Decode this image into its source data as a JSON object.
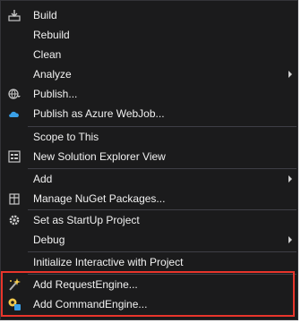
{
  "colors": {
    "menu_background": "#1b1b1c",
    "text": "#f1f1f1",
    "separator": "#3f3f46",
    "highlight_border": "#e8352b",
    "icon_blue": "#3aa0e8"
  },
  "menu": {
    "items": [
      {
        "label": "Build",
        "icon": "build-icon"
      },
      {
        "label": "Rebuild",
        "icon": ""
      },
      {
        "label": "Clean",
        "icon": ""
      },
      {
        "label": "Analyze",
        "icon": "",
        "submenu": true
      },
      {
        "label": "Publish...",
        "icon": "globe-publish-icon"
      },
      {
        "label": "Publish as Azure WebJob...",
        "icon": "azure-cloud-icon"
      },
      {
        "label": "Scope to This",
        "icon": ""
      },
      {
        "label": "New Solution Explorer View",
        "icon": "solution-explorer-icon"
      },
      {
        "label": "Add",
        "icon": "",
        "submenu": true
      },
      {
        "label": "Manage NuGet Packages...",
        "icon": "nuget-package-icon"
      },
      {
        "label": "Set as StartUp Project",
        "icon": "gear-icon"
      },
      {
        "label": "Debug",
        "icon": "",
        "submenu": true
      },
      {
        "label": "Initialize Interactive with Project",
        "icon": ""
      },
      {
        "label": "Add RequestEngine...",
        "icon": "magic-wand-icon"
      },
      {
        "label": "Add CommandEngine...",
        "icon": "command-engine-icon"
      }
    ]
  }
}
